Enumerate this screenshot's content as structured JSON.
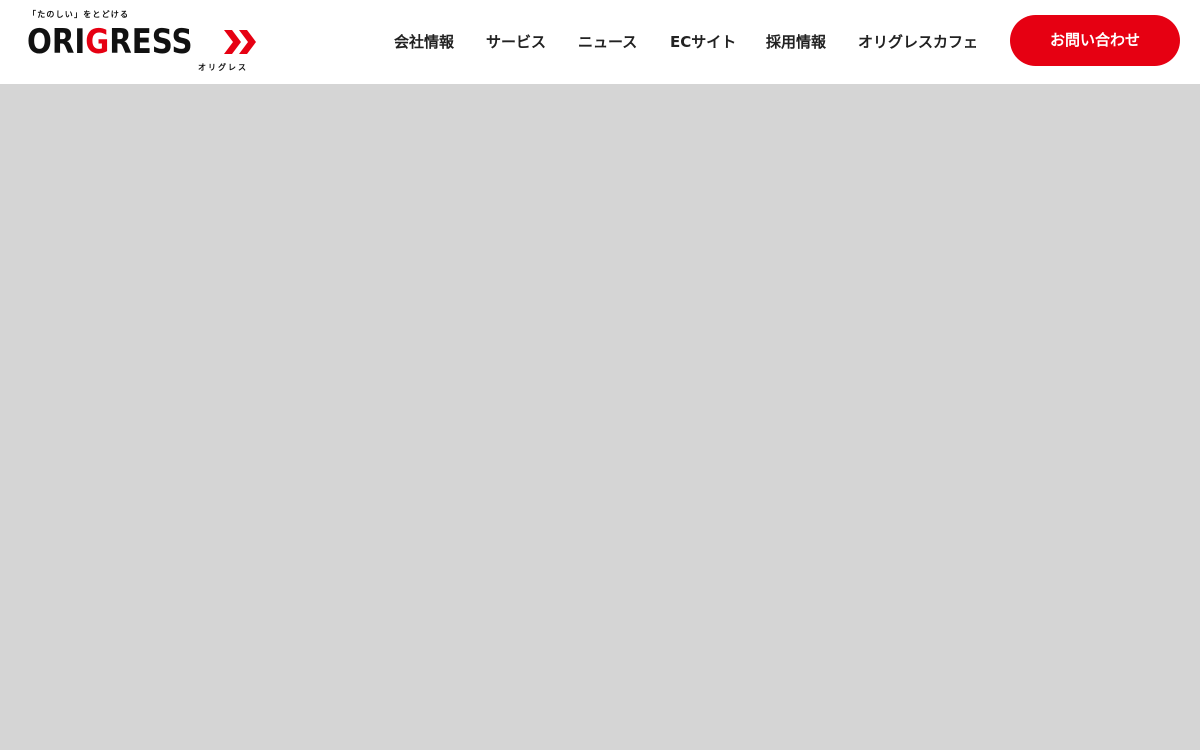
{
  "header": {
    "logo": {
      "tagline": "「たのしい」をとどける",
      "wordmark_part1": "ORI",
      "wordmark_accent": "G",
      "wordmark_part2": "RESS",
      "kana": "オリグレス",
      "chevron_icon": "double-chevron-right-icon"
    },
    "nav": [
      {
        "label": "会社情報"
      },
      {
        "label": "サービス"
      },
      {
        "label": "ニュース"
      },
      {
        "label": "ECサイト"
      },
      {
        "label": "採用情報"
      },
      {
        "label": "オリグレスカフェ"
      }
    ],
    "contact_label": "お問い合わせ"
  },
  "colors": {
    "brand_red": "#e60012",
    "text_dark": "#222222",
    "header_bg": "#ffffff",
    "hero_placeholder_bg": "#d5d5d5"
  }
}
